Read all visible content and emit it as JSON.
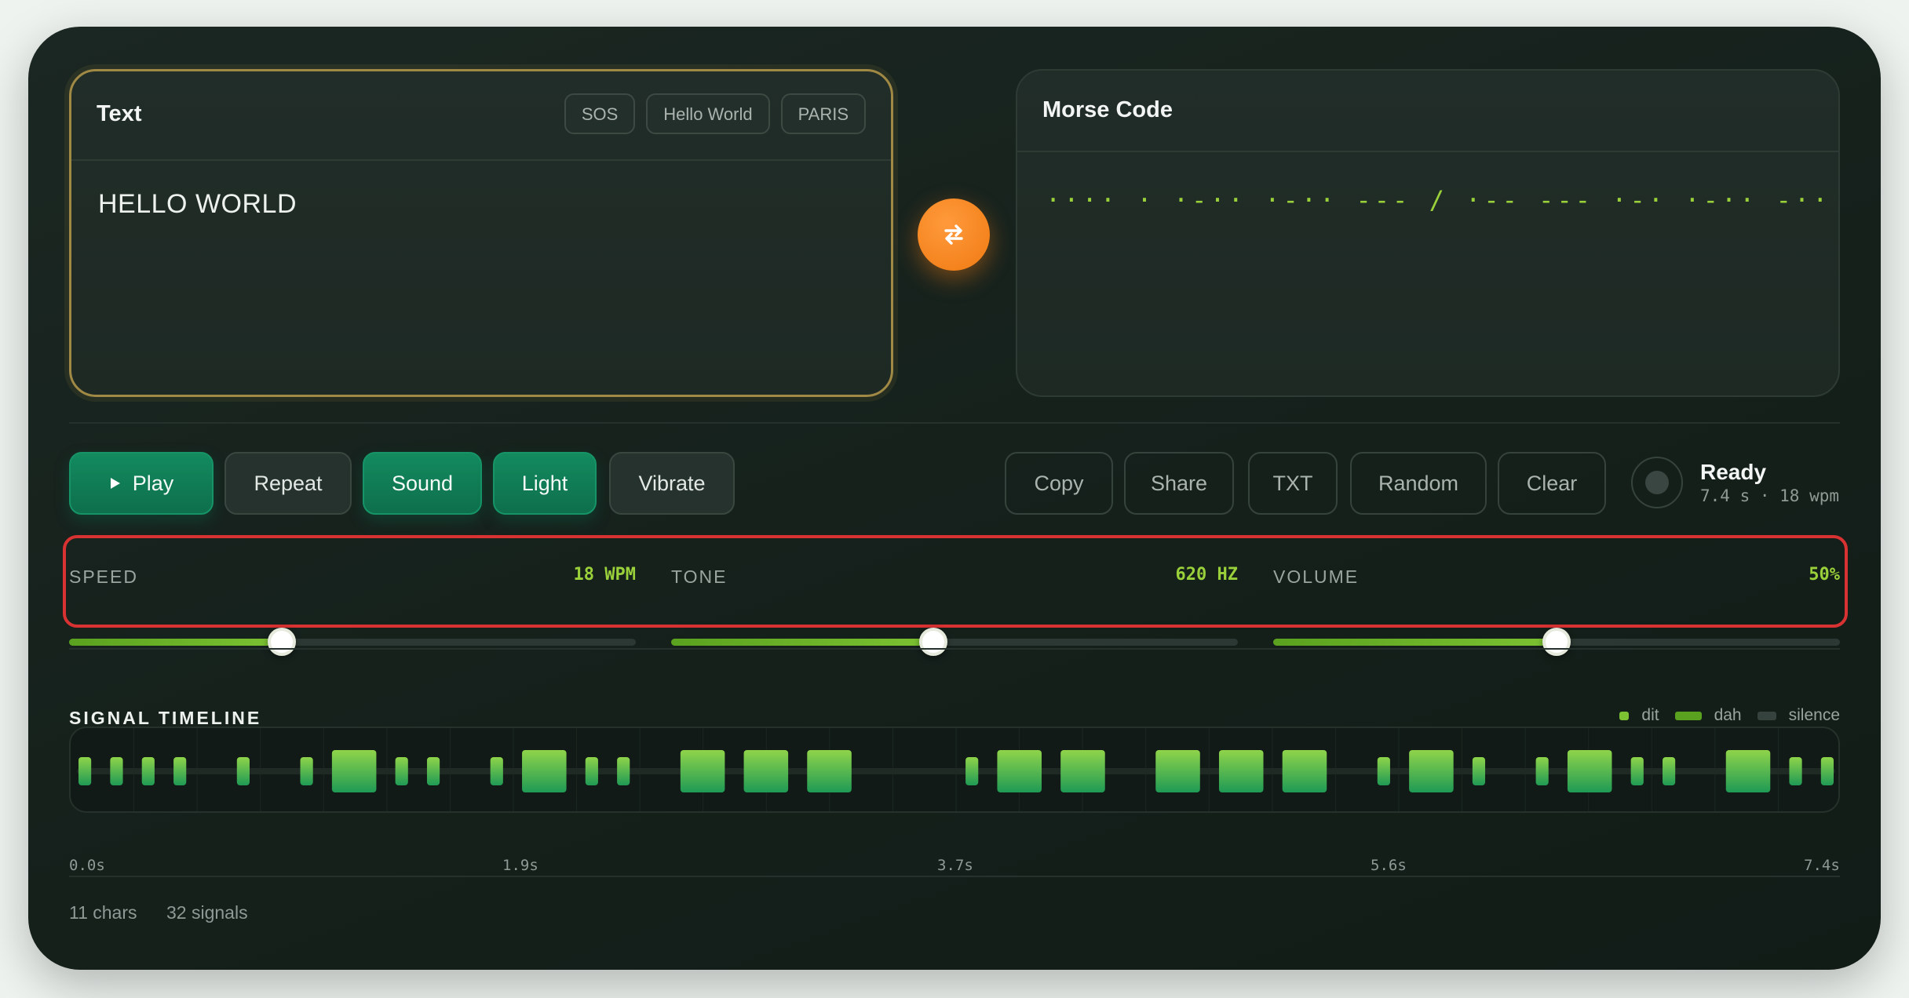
{
  "text_panel": {
    "title": "Text",
    "presets": [
      "SOS",
      "Hello World",
      "PARIS"
    ],
    "value": "HELLO WORLD"
  },
  "swap_icon": "swap-arrows-icon",
  "morse_panel": {
    "title": "Morse Code",
    "value": "···· · ·-·· ·-·· --- / ·-- --- ·-· ·-·· -··"
  },
  "toolbar": {
    "play": "Play",
    "repeat": "Repeat",
    "sound": "Sound",
    "light": "Light",
    "vibrate": "Vibrate",
    "copy": "Copy",
    "share": "Share",
    "txt": "TXT",
    "random": "Random",
    "clear": "Clear"
  },
  "status": {
    "title": "Ready",
    "meta": "7.4 s · 18 wpm"
  },
  "sliders": [
    {
      "label": "SPEED",
      "value": "18 WPM",
      "level": 0.375
    },
    {
      "label": "TONE",
      "value": "620 HZ",
      "level": 0.463
    },
    {
      "label": "VOLUME",
      "value": "50%",
      "level": 0.5
    }
  ],
  "timeline": {
    "title": "SIGNAL TIMELINE",
    "legend": [
      "dit",
      "dah",
      "silence"
    ],
    "ticks": [
      "0.0s",
      "1.9s",
      "3.7s",
      "5.6s",
      "7.4s"
    ]
  },
  "footer": {
    "chars": "11 chars",
    "signals": "32 signals"
  },
  "colors": {
    "accent": "#9ad03a",
    "primary": "#138a5f",
    "swap": "#f07a12",
    "highlight": "#d83232"
  }
}
